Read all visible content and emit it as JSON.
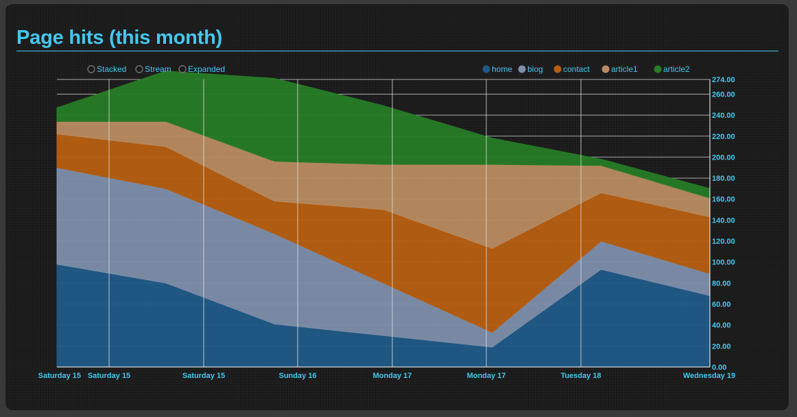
{
  "page_title": "Page hits (this month)",
  "controls": [
    {
      "label": "Stacked",
      "selected": false
    },
    {
      "label": "Stream",
      "selected": false
    },
    {
      "label": "Expanded",
      "selected": false
    }
  ],
  "colors": {
    "accent": "#43c8ef",
    "home": "#1f5a86",
    "blog": "#7d8ea9",
    "contact": "#b55e11",
    "article1": "#b88a5f",
    "article2": "#277b25"
  },
  "chart_data": {
    "type": "area",
    "stacked": true,
    "title": "Page hits (this month)",
    "x_tick_labels": [
      "Saturday 15",
      "Saturday 15",
      "Saturday 15",
      "Sunday 16",
      "Monday 17",
      "Monday 17",
      "Tuesday 18",
      "Wednesday 19"
    ],
    "x_tick_labels_highlighted": [
      0,
      7
    ],
    "x": [
      0,
      1,
      2,
      3,
      4,
      5,
      6
    ],
    "x_range": [
      0,
      6
    ],
    "series": [
      {
        "name": "home",
        "color": "#1f5a86",
        "values": [
          98,
          80,
          41,
          30,
          19,
          93,
          68
        ]
      },
      {
        "name": "blog",
        "color": "#7d8ea9",
        "values": [
          92,
          90,
          86,
          50,
          14,
          27,
          21
        ]
      },
      {
        "name": "contact",
        "color": "#b55e11",
        "values": [
          32,
          40,
          31,
          70,
          80,
          46,
          54
        ]
      },
      {
        "name": "article1",
        "color": "#b88a5f",
        "values": [
          12,
          24,
          38,
          43,
          80,
          26,
          18
        ]
      },
      {
        "name": "article2",
        "color": "#277b25",
        "values": [
          13,
          48,
          79,
          56,
          25,
          6,
          9
        ]
      }
    ],
    "y_range": [
      0,
      274
    ],
    "y_tick_labels": [
      "0.00",
      "20.00",
      "40.00",
      "60.00",
      "80.00",
      "100.00",
      "120.00",
      "140.00",
      "160.00",
      "180.00",
      "200.00",
      "220.00",
      "240.00",
      "260.00",
      "274.00"
    ],
    "y_axis_position": "right",
    "grid": true,
    "legend_position": "top-right"
  }
}
